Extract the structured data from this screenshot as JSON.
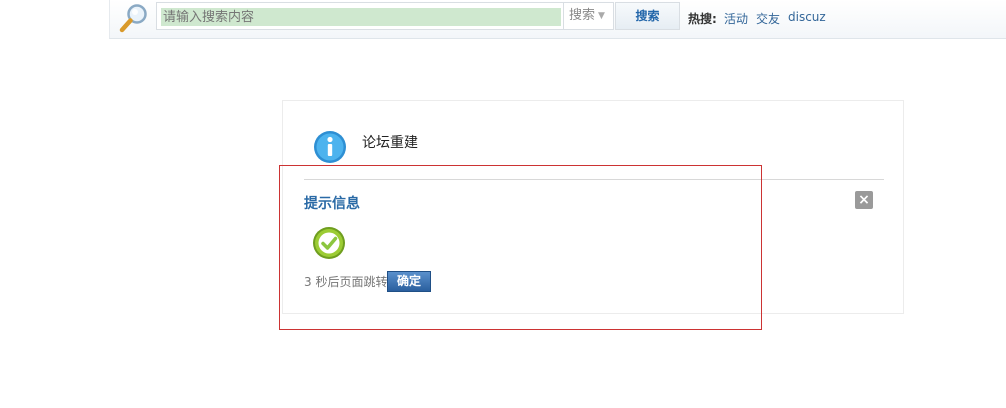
{
  "search": {
    "placeholder": "请输入搜索内容",
    "type_label": "搜索",
    "button_label": "搜索",
    "hot_label": "热搜:",
    "hot_links": [
      "活动",
      "交友",
      "discuz"
    ]
  },
  "panel": {
    "title": "论坛重建",
    "close_glyph": "×"
  },
  "dialog": {
    "title": "提示信息",
    "redirect_text": "3 秒后页面跳转",
    "confirm_label": "确定"
  },
  "icons": {
    "search": "magnifier-icon",
    "info": "info-icon",
    "success": "check-icon",
    "close": "close-icon"
  },
  "colors": {
    "link": "#336699",
    "title": "#2a6aa6",
    "highlight_frame": "#cc3333",
    "success": "#8cc63f",
    "info": "#35a3e4"
  }
}
